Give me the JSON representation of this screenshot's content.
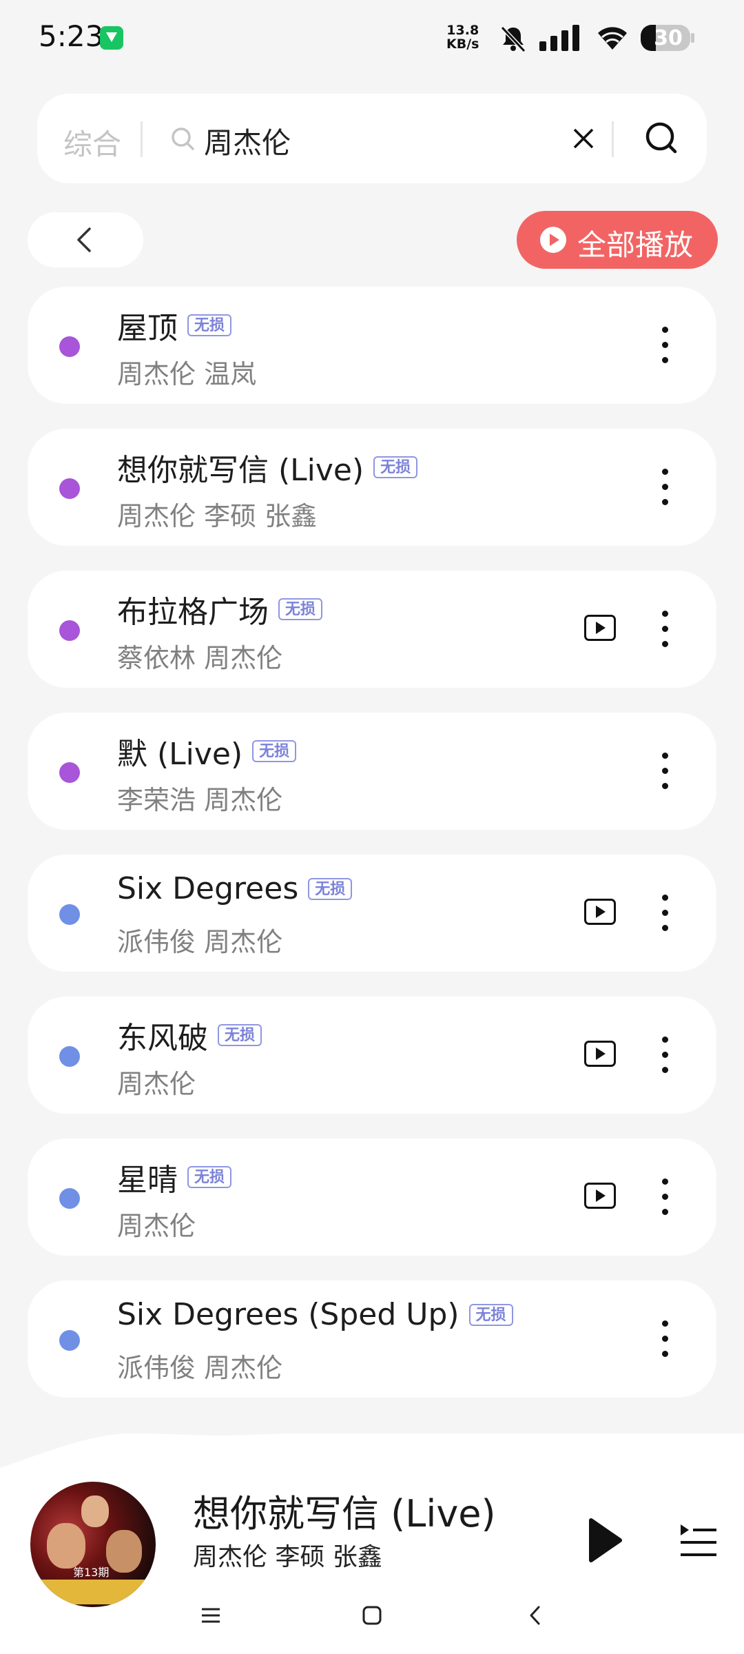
{
  "status_bar": {
    "time": "5:23",
    "net_speed_value": "13.8",
    "net_speed_unit": "KB/s",
    "battery": "30"
  },
  "search": {
    "category": "综合",
    "query": "周杰伦"
  },
  "actions": {
    "play_all_label": "全部播放"
  },
  "colors": {
    "accent": "#f26464",
    "badge": "#7b82d8",
    "dot_purple": "#a855d9",
    "dot_blue": "#7090e6"
  },
  "songs": [
    {
      "title": "屋顶",
      "badge": "无损",
      "artists": "周杰伦 温岚",
      "has_mv": false,
      "dot": "#a855d9"
    },
    {
      "title": "想你就写信 (Live)",
      "badge": "无损",
      "artists": "周杰伦 李硕 张鑫",
      "has_mv": false,
      "dot": "#a855d9"
    },
    {
      "title": "布拉格广场",
      "badge": "无损",
      "artists": "蔡依林 周杰伦",
      "has_mv": true,
      "dot": "#a855d9"
    },
    {
      "title": "默 (Live)",
      "badge": "无损",
      "artists": "李荣浩 周杰伦",
      "has_mv": false,
      "dot": "#a855d9"
    },
    {
      "title": "Six Degrees",
      "badge": "无损",
      "artists": "派伟俊 周杰伦",
      "has_mv": true,
      "dot": "#7090e6"
    },
    {
      "title": "东风破",
      "badge": "无损",
      "artists": "周杰伦",
      "has_mv": true,
      "dot": "#7090e6"
    },
    {
      "title": "星晴",
      "badge": "无损",
      "artists": "周杰伦",
      "has_mv": true,
      "dot": "#7090e6"
    },
    {
      "title": "Six Degrees (Sped Up)",
      "badge": "无损",
      "artists": "派伟俊 周杰伦",
      "has_mv": false,
      "dot": "#7090e6"
    }
  ],
  "now_playing": {
    "title": "想你就写信 (Live)",
    "artists": "周杰伦 李硕 张鑫",
    "cover_episode": "第13期"
  }
}
